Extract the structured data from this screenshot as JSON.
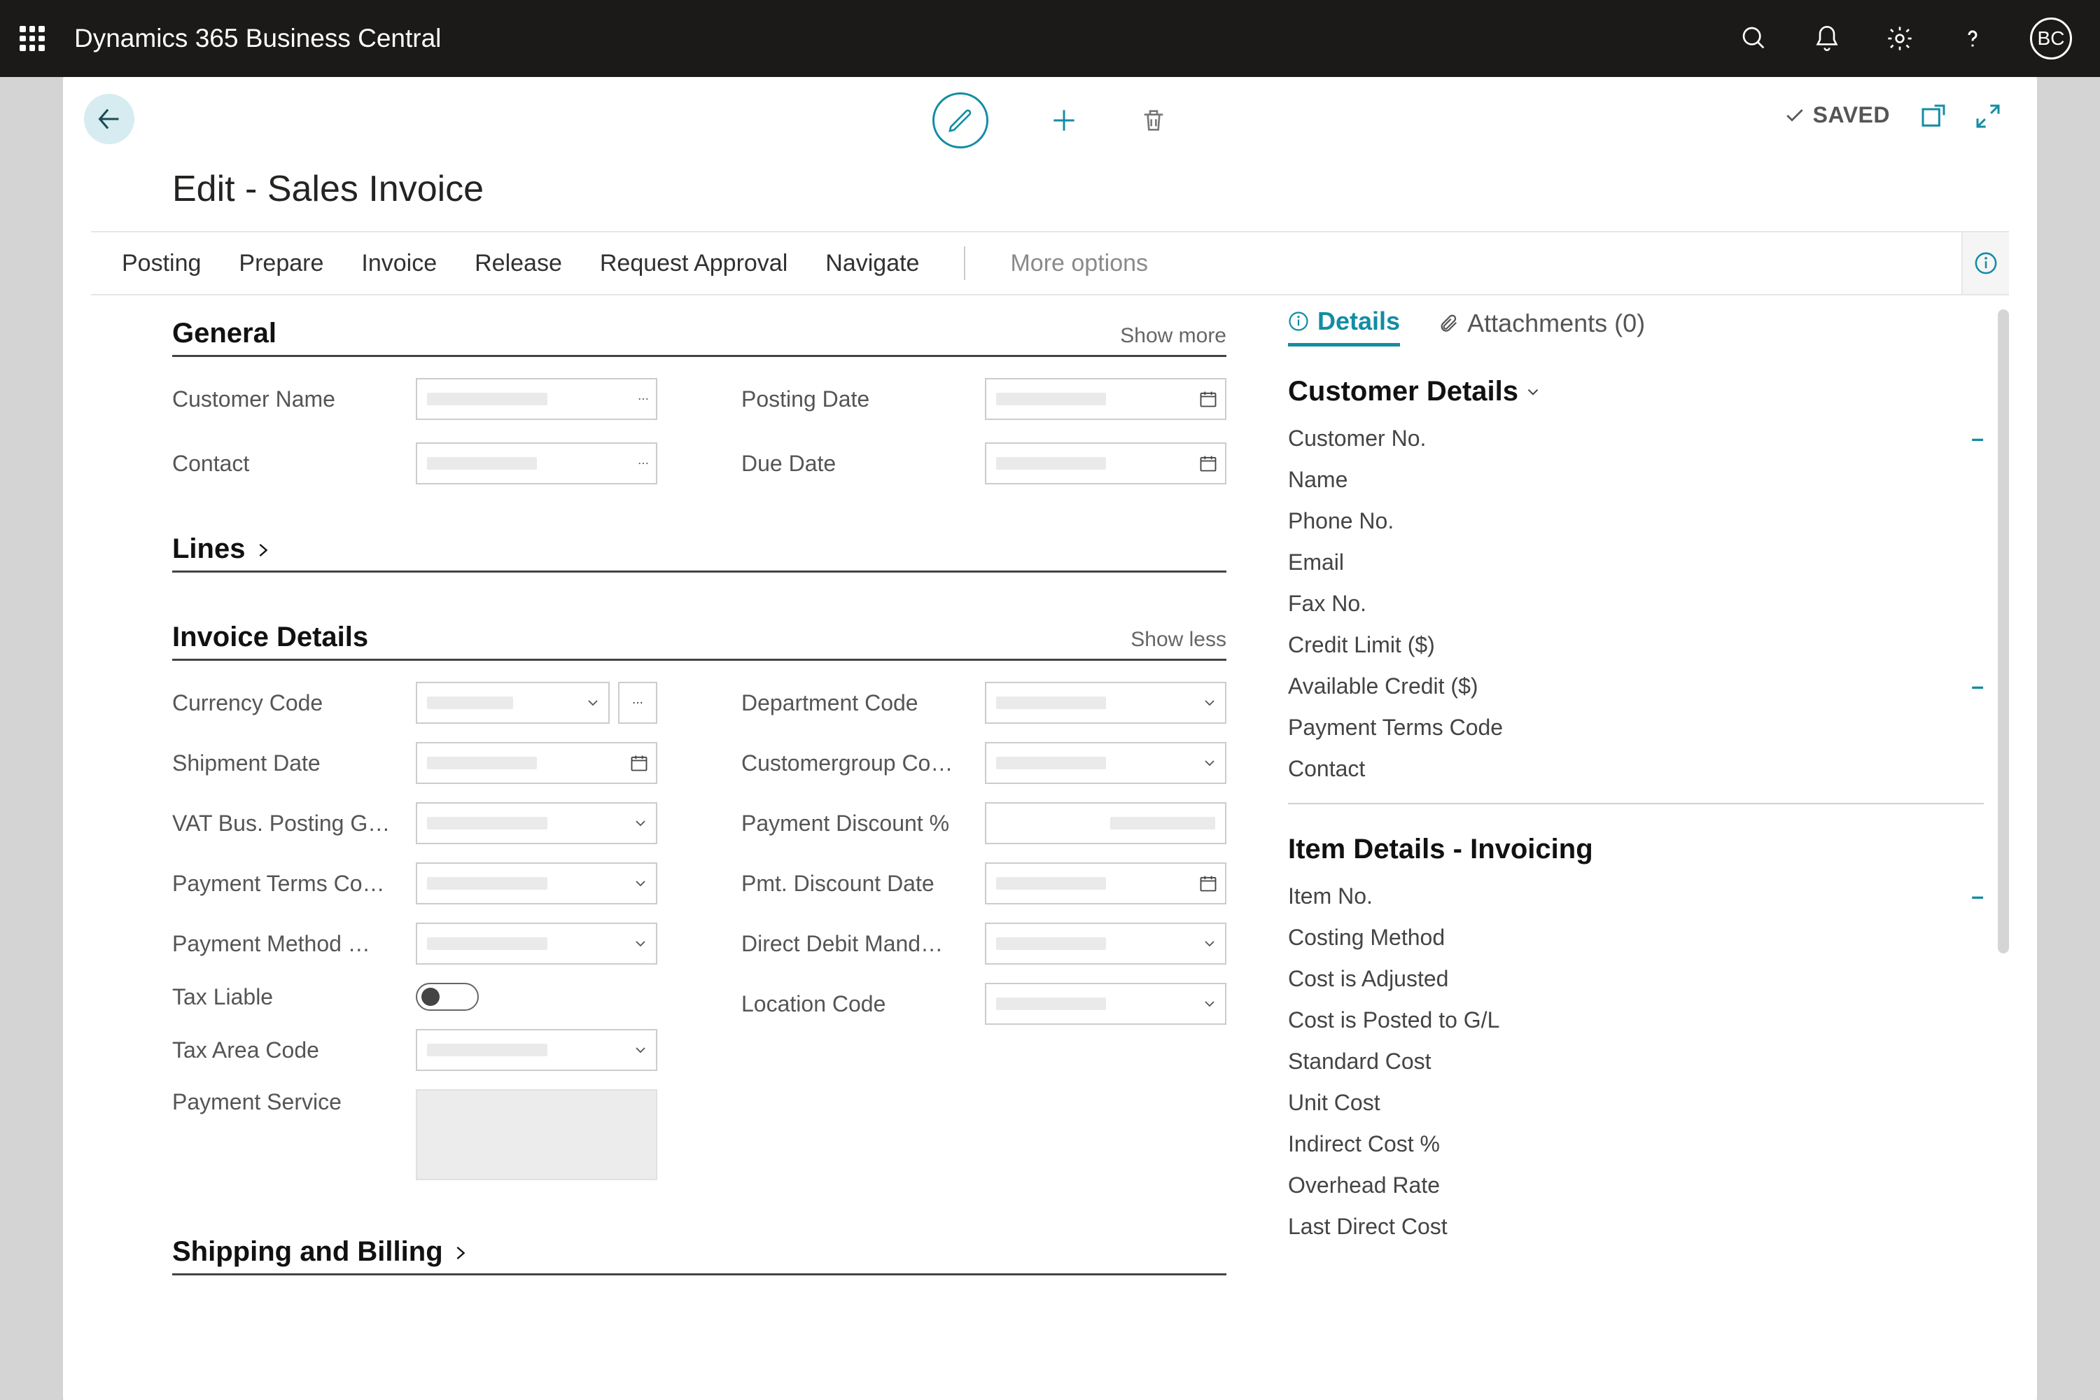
{
  "topbar": {
    "title": "Dynamics 365 Business Central",
    "avatar_initials": "BC"
  },
  "card": {
    "save_status": "SAVED",
    "page_title": "Edit - Sales Invoice"
  },
  "actions": {
    "items": [
      "Posting",
      "Prepare",
      "Invoice",
      "Release",
      "Request Approval",
      "Navigate"
    ],
    "more": "More options"
  },
  "sections": {
    "general": {
      "title": "General",
      "show_more": "Show more"
    },
    "lines": {
      "title": "Lines"
    },
    "invoice_details": {
      "title": "Invoice Details",
      "show_less": "Show less"
    },
    "shipping_billing": {
      "title": "Shipping and Billing"
    }
  },
  "fields_general": {
    "left": [
      {
        "label": "Customer Name",
        "kind": "lookup-ellipsis"
      },
      {
        "label": "Contact",
        "kind": "lookup-ellipsis"
      }
    ],
    "right": [
      {
        "label": "Posting Date",
        "kind": "date"
      },
      {
        "label": "Due Date",
        "kind": "date"
      }
    ]
  },
  "fields_invoice_details": {
    "left": [
      {
        "label": "Currency Code",
        "kind": "dropdown-plus-ellipsis"
      },
      {
        "label": "Shipment Date",
        "kind": "date"
      },
      {
        "label": "VAT Bus. Posting G…",
        "kind": "dropdown"
      },
      {
        "label": "Payment Terms Co…",
        "kind": "dropdown"
      },
      {
        "label": "Payment Method …",
        "kind": "dropdown"
      },
      {
        "label": "Tax Liable",
        "kind": "toggle"
      },
      {
        "label": "Tax Area Code",
        "kind": "dropdown"
      },
      {
        "label": "Payment Service",
        "kind": "disabled-area"
      }
    ],
    "right": [
      {
        "label": "Department Code",
        "kind": "dropdown"
      },
      {
        "label": "Customergroup Co…",
        "kind": "dropdown"
      },
      {
        "label": "Payment Discount %",
        "kind": "numeric-right"
      },
      {
        "label": "Pmt. Discount Date",
        "kind": "date"
      },
      {
        "label": "Direct Debit Mand…",
        "kind": "dropdown"
      },
      {
        "label": "Location Code",
        "kind": "dropdown"
      }
    ]
  },
  "factbox": {
    "tabs": {
      "details": "Details",
      "attachments": "Attachments (0)"
    },
    "customer_details": {
      "title": "Customer Details",
      "rows": [
        {
          "label": "Customer No.",
          "dash": true
        },
        {
          "label": "Name"
        },
        {
          "label": "Phone No."
        },
        {
          "label": "Email"
        },
        {
          "label": "Fax No."
        },
        {
          "label": "Credit Limit ($)"
        },
        {
          "label": "Available Credit ($)",
          "dash": true
        },
        {
          "label": "Payment Terms Code"
        },
        {
          "label": "Contact"
        }
      ]
    },
    "item_details": {
      "title": "Item Details - Invoicing",
      "rows": [
        {
          "label": "Item No.",
          "dash": true
        },
        {
          "label": "Costing Method"
        },
        {
          "label": "Cost is Adjusted"
        },
        {
          "label": "Cost is Posted to G/L"
        },
        {
          "label": "Standard Cost"
        },
        {
          "label": "Unit Cost"
        },
        {
          "label": "Indirect Cost %"
        },
        {
          "label": "Overhead Rate"
        },
        {
          "label": "Last Direct Cost"
        }
      ]
    }
  }
}
